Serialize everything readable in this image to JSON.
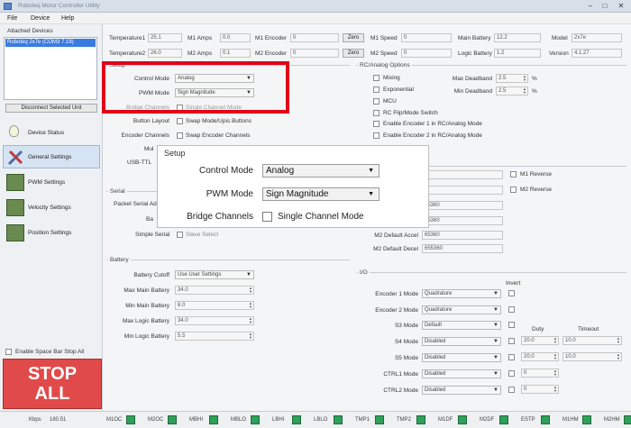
{
  "window": {
    "title": "Roboteq Motor Controller Utility"
  },
  "menu": {
    "file": "File",
    "device": "Device",
    "help": "Help"
  },
  "left": {
    "attached_devices_label": "Attached Devices",
    "selected_device": "Roboteq 2x7e (COM3 7.19)",
    "disconnect_label": "Disconnect Selected Unit",
    "nav": [
      "Device Status",
      "General Settings",
      "PWM Settings",
      "Velocity Settings",
      "Position Settings"
    ],
    "space_bar_label": "Enable Space Bar Stop All",
    "stop_line1": "STOP",
    "stop_line2": "ALL"
  },
  "top": {
    "temperature1_label": "Temperature1",
    "temperature1": "25.1",
    "temperature2_label": "Temperature2",
    "temperature2": "26.0",
    "m1amps_label": "M1 Amps",
    "m1amps": "0.0",
    "m2amps_label": "M2 Amps",
    "m2amps": "0.1",
    "m1enc_label": "M1 Encoder",
    "m1enc": "0",
    "m2enc_label": "M2 Encoder",
    "m2enc": "0",
    "zero_label": "Zero",
    "m1speed_label": "M1 Speed",
    "m1speed": "0",
    "m2speed_label": "M2 Speed",
    "m2speed": "0",
    "main_battery_label": "Main Battery",
    "main_battery": "12.2",
    "logic_battery_label": "Logic Battery",
    "logic_battery": "1.2",
    "model_label": "Model",
    "model": "2x7e",
    "version_label": "Version",
    "version": "4.1.27"
  },
  "setup": {
    "group": "Setup",
    "control_mode_label": "Control Mode",
    "control_mode": "Analog",
    "pwm_mode_label": "PWM Mode",
    "pwm_mode": "Sign Magnitude",
    "bridge_label": "Bridge Channels",
    "bridge_option": "Single Channel Mode",
    "button_layout_label": "Button Layout",
    "button_layout_option": "Swap Mode/Upis Buttons",
    "encoder_channels_label": "Encoder Channels",
    "encoder_channels_option": "Swap Encoder Channels",
    "multi_label": "Mul",
    "usb_label": "USB-TTL"
  },
  "rc": {
    "group": "RC/Analog Options",
    "mixing": "Mixing",
    "exponential": "Exponential",
    "mcu": "MCU",
    "flip": "RC Flip/Mode Switch",
    "enc1": "Enable Encoder 1 in RC/Analog Mode",
    "enc2": "Enable Encoder 2 in RC/Analog Mode",
    "max_deadband_label": "Max Deadband",
    "max_deadband": "2.5",
    "min_deadband_label": "Min Deadband",
    "min_deadband": "2.5",
    "pct": "%"
  },
  "motor": {
    "m1_reverse": "M1 Reverse",
    "m2_reverse": "M2 Reverse",
    "val1": "0",
    "val2": "0",
    "val3": "65360",
    "val4": "65360",
    "m2accel_label": "M2 Default Accel",
    "m2accel": "65360",
    "m2decel_label": "M2 Default Decel",
    "m2decel": "655360"
  },
  "serial": {
    "group": "Serial",
    "packet_label": "Packet Serial Ad",
    "ba_label": "Ba",
    "simple_label": "Simple Serial",
    "slave_label": "Slave Select"
  },
  "battery": {
    "group": "Battery",
    "cutoff_label": "Battery Cutoff",
    "cutoff": "Use User Settings",
    "max_main_label": "Max Main Battery",
    "max_main": "34.0",
    "min_main_label": "Min Main Battery",
    "min_main": "6.0",
    "max_logic_label": "Max Logic Battery",
    "max_logic": "34.0",
    "min_logic_label": "Min Logic Battery",
    "min_logic": "5.5"
  },
  "io": {
    "group": "I/O",
    "invert_label": "Invert",
    "duty_label": "Duty",
    "timeout_label": "Timeout",
    "rows": [
      {
        "label": "Encoder 1 Mode",
        "value": "Quadrature"
      },
      {
        "label": "Encoder 2 Mode",
        "value": "Quadrature"
      },
      {
        "label": "S3 Mode",
        "value": "Default"
      },
      {
        "label": "S4 Mode",
        "value": "Disabled",
        "duty": "20.0",
        "timeout": "10.0"
      },
      {
        "label": "S5 Mode",
        "value": "Disabled",
        "duty": "20.0",
        "timeout": "10.0"
      },
      {
        "label": "CTRL1 Mode",
        "value": "Disabled",
        "num": "0"
      },
      {
        "label": "CTRL2 Mode",
        "value": "Disabled",
        "num": "0"
      }
    ]
  },
  "popup": {
    "title": "Setup",
    "control_mode_label": "Control Mode",
    "control_mode": "Analog",
    "pwm_mode_label": "PWM Mode",
    "pwm_mode": "Sign Magnitude",
    "bridge_label": "Bridge Channels",
    "bridge_option": "Single Channel Mode"
  },
  "status": {
    "kbps_label": "Kbps",
    "kbps": "180.51",
    "indicators": [
      "M1OC",
      "M2OC",
      "MBHI",
      "MBLO",
      "LBHI",
      "LBLO",
      "TMP1",
      "TMP2",
      "M1DF",
      "M2DF",
      "ESTP",
      "M1HM",
      "M2HM"
    ]
  },
  "colors": {
    "accent": "#e2001a",
    "stop": "#e14a4a",
    "indicator": "#2fa05a",
    "selection": "#3a7be0"
  }
}
